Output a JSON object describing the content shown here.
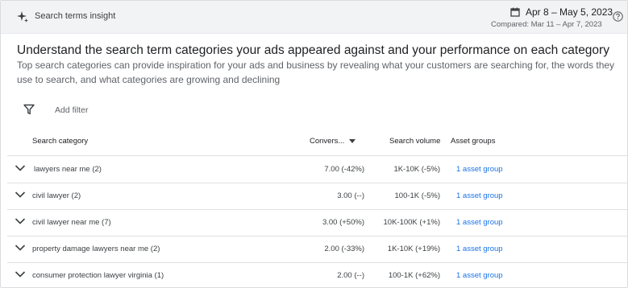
{
  "header": {
    "title": "Search terms insight",
    "date_range": "Apr 8 – May 5, 2023",
    "compared": "Compared: Mar 11 – Apr 7, 2023",
    "icons": [
      "sparkle-icon",
      "calendar-icon",
      "help-icon"
    ]
  },
  "intro": {
    "heading": "Understand the search term categories your ads appeared against and your performance on each category",
    "description": "Top search categories can provide inspiration for your ads and business by revealing what your customers are searching for, the words they use to search, and what categories are growing and declining"
  },
  "filter": {
    "label": "Add filter",
    "icon": "filter-icon"
  },
  "table": {
    "columns": {
      "category": "Search category",
      "conversions": "Convers...",
      "volume": "Search volume",
      "asset_groups": "Asset groups"
    },
    "rows": [
      {
        "category": "lawyers near me (2)",
        "conversions": "7.00 (-42%)",
        "volume": "1K-10K (-5%)",
        "asset": "1 asset group"
      },
      {
        "category": "civil lawyer (2)",
        "conversions": "3.00 (--)",
        "volume": "100-1K (-5%)",
        "asset": "1 asset group"
      },
      {
        "category": "civil lawyer near me (7)",
        "conversions": "3.00 (+50%)",
        "volume": "10K-100K (+1%)",
        "asset": "1 asset group"
      },
      {
        "category": "property damage lawyers near me (2)",
        "conversions": "2.00 (-33%)",
        "volume": "1K-10K (+19%)",
        "asset": "1 asset group"
      },
      {
        "category": "consumer protection lawyer virginia (1)",
        "conversions": "2.00 (--)",
        "volume": "100-1K (+62%)",
        "asset": "1 asset group"
      }
    ]
  },
  "colors": {
    "link": "#1a73e8",
    "header_bg": "#f1f3f4",
    "text": "#202124",
    "secondary_text": "#5f6368"
  }
}
